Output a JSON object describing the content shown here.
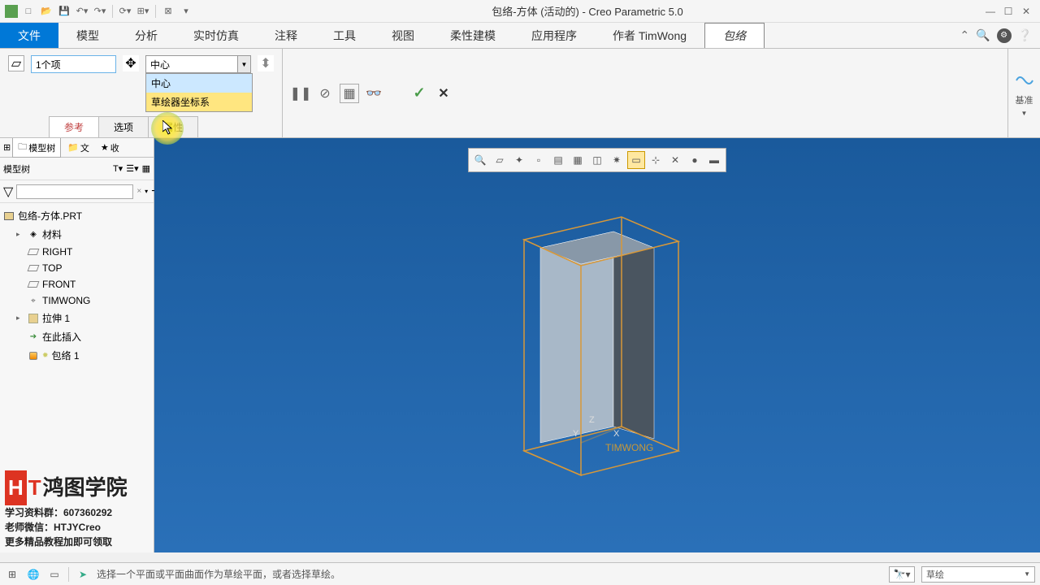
{
  "title": "包络-方体 (活动的) - Creo Parametric 5.0",
  "menus": [
    "文件",
    "模型",
    "分析",
    "实时仿真",
    "注释",
    "工具",
    "视图",
    "柔性建模",
    "应用程序",
    "作者 TimWong",
    "包络"
  ],
  "ribbon": {
    "selection_label": "1个项",
    "combo_value": "中心",
    "combo_options": [
      "中心",
      "草绘器坐标系"
    ],
    "tabs": [
      "参考",
      "选项",
      "属性"
    ],
    "right_label": "基准"
  },
  "sidebar": {
    "tabs": [
      "模型树",
      "文",
      "收"
    ],
    "toolbar_label": "模型树",
    "tree": [
      {
        "label": "包络-方体.PRT",
        "icon": "box",
        "indent": 0
      },
      {
        "label": "材料",
        "icon": "mat",
        "indent": 1,
        "exp": "▸"
      },
      {
        "label": "RIGHT",
        "icon": "plane",
        "indent": 1
      },
      {
        "label": "TOP",
        "icon": "plane",
        "indent": 1
      },
      {
        "label": "FRONT",
        "icon": "plane",
        "indent": 1
      },
      {
        "label": "TIMWONG",
        "icon": "csys",
        "indent": 1
      },
      {
        "label": "拉伸 1",
        "icon": "ext",
        "indent": 1,
        "exp": "▸"
      },
      {
        "label": "在此插入",
        "icon": "arrow",
        "indent": 1
      },
      {
        "label": "包络 1",
        "icon": "env",
        "indent": 1,
        "star": true
      }
    ]
  },
  "watermark": {
    "brand": "鸿图学院",
    "line1": "学习资料群：607360292",
    "line2": "老师微信：HTJYCreo",
    "line3": "更多精品教程加即可领取"
  },
  "canvas": {
    "axes": {
      "x": "X",
      "y": "Y",
      "z": "Z"
    },
    "csys_label": "TIMWONG"
  },
  "statusbar": {
    "hint": "选择一个平面或平面曲面作为草绘平面，或者选择草绘。",
    "mode": "草绘"
  }
}
